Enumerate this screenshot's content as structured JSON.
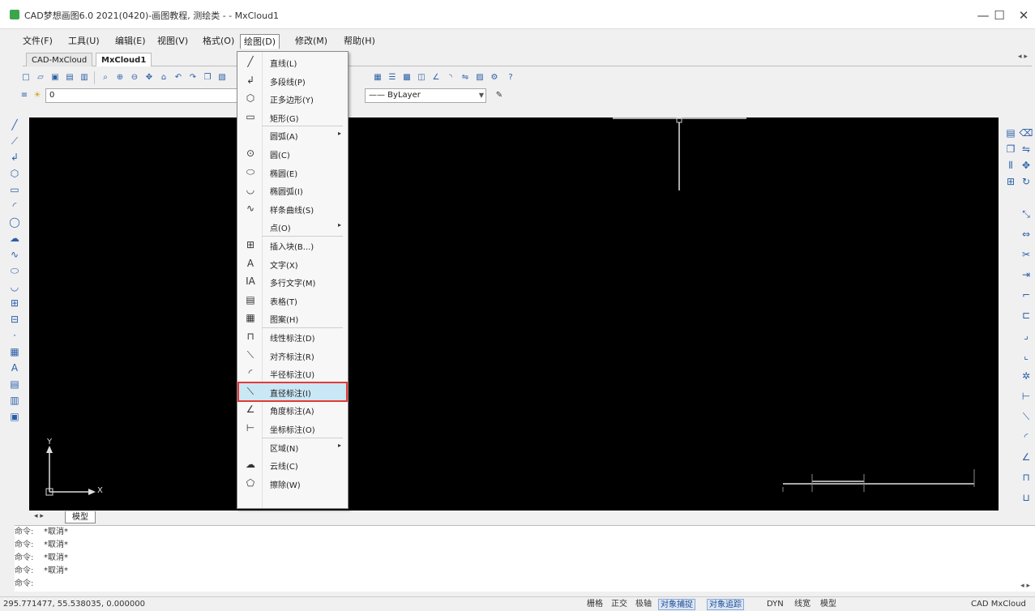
{
  "window": {
    "title": "CAD梦想画图6.0 2021(0420)-画图教程, 测绘类 - - MxCloud1",
    "minimize": "—",
    "maximize": "☐",
    "close": "✕"
  },
  "menubar": {
    "items": [
      "文件(F)",
      "工具(U)",
      "编辑(E)",
      "视图(V)",
      "格式(O)",
      "绘图(D)",
      "修改(M)",
      "帮助(H)"
    ],
    "active_index": 5
  },
  "doc_tabs": {
    "tabs": [
      "CAD-MxCloud",
      "MxCloud1"
    ],
    "active_index": 1,
    "arrows": "◂ ▸"
  },
  "layer_combo": {
    "value": "0"
  },
  "linetype_combo": {
    "value": "—— ByLayer"
  },
  "dropdown": {
    "items": [
      {
        "icon": "line-icon",
        "glyph": "╱",
        "label": "直线(L)"
      },
      {
        "icon": "polyline-icon",
        "glyph": "↲",
        "label": "多段线(P)"
      },
      {
        "icon": "polygon-icon",
        "glyph": "⬡",
        "label": "正多边形(Y)"
      },
      {
        "icon": "rectangle-icon",
        "glyph": "▭",
        "label": "矩形(G)"
      },
      {
        "icon": "arc-icon",
        "glyph": "",
        "label": "圆弧(A)",
        "submenu": true
      },
      {
        "icon": "circle-icon",
        "glyph": "⊙",
        "label": "圆(C)"
      },
      {
        "icon": "ellipse-icon",
        "glyph": "⬭",
        "label": "椭圆(E)"
      },
      {
        "icon": "ellipse-arc-icon",
        "glyph": "◡",
        "label": "椭圆弧(I)"
      },
      {
        "icon": "spline-icon",
        "glyph": "∿",
        "label": "样条曲线(S)"
      },
      {
        "icon": "point-icon",
        "glyph": "",
        "label": "点(O)",
        "submenu": true
      },
      {
        "icon": "insert-block-icon",
        "glyph": "⊞",
        "label": "插入块(B...)"
      },
      {
        "icon": "text-icon",
        "glyph": "A",
        "label": "文字(X)"
      },
      {
        "icon": "mtext-icon",
        "glyph": "IA",
        "label": "多行文字(M)"
      },
      {
        "icon": "table-icon",
        "glyph": "▤",
        "label": "表格(T)"
      },
      {
        "icon": "hatch-icon",
        "glyph": "▦",
        "label": "图案(H)"
      },
      {
        "icon": "linear-dimension-icon",
        "glyph": "⊓",
        "label": "线性标注(D)"
      },
      {
        "icon": "aligned-dimension-icon",
        "glyph": "⟍",
        "label": "对齐标注(R)"
      },
      {
        "icon": "radius-dimension-icon",
        "glyph": "◜",
        "label": "半径标注(U)"
      },
      {
        "icon": "diameter-dimension-icon",
        "glyph": "⟍",
        "label": "直径标注(I)"
      },
      {
        "icon": "angular-dimension-icon",
        "glyph": "∠",
        "label": "角度标注(A)"
      },
      {
        "icon": "ordinate-dimension-icon",
        "glyph": "⊢",
        "label": "坐标标注(O)"
      },
      {
        "icon": "region-icon",
        "glyph": "",
        "label": "区域(N)",
        "submenu": true
      },
      {
        "icon": "cloud-icon",
        "glyph": "☁",
        "label": "云线(C)"
      },
      {
        "icon": "wipeout-icon",
        "glyph": "⬠",
        "label": "擦除(W)"
      }
    ],
    "highlight_index": 18,
    "submenu_arrow": "▸"
  },
  "layout_tabs": {
    "nav": "◂ ▸",
    "model": "模型"
  },
  "command": {
    "lines": [
      {
        "k": "命令:",
        "v": "*取消*"
      },
      {
        "k": "命令:",
        "v": "*取消*"
      },
      {
        "k": "命令:",
        "v": "*取消*"
      },
      {
        "k": "命令:",
        "v": "*取消*"
      },
      {
        "k": "命令:",
        "v": ""
      }
    ],
    "scroll": "◂ ▸"
  },
  "status": {
    "coords": "295.771477, 55.538035, 0.000000",
    "items": [
      {
        "label": "栅格",
        "on": false
      },
      {
        "label": "正交",
        "on": false
      },
      {
        "label": "极轴",
        "on": false
      },
      {
        "label": "对象捕捉",
        "on": true
      },
      {
        "label": "对象追踪",
        "on": true
      },
      {
        "label": "DYN",
        "on": false
      },
      {
        "label": "线宽",
        "on": false
      },
      {
        "label": "模型",
        "on": false
      },
      {
        "label": "CAD MxCloud",
        "on": false
      }
    ]
  },
  "axis": {
    "x": "X",
    "y": "Y"
  }
}
